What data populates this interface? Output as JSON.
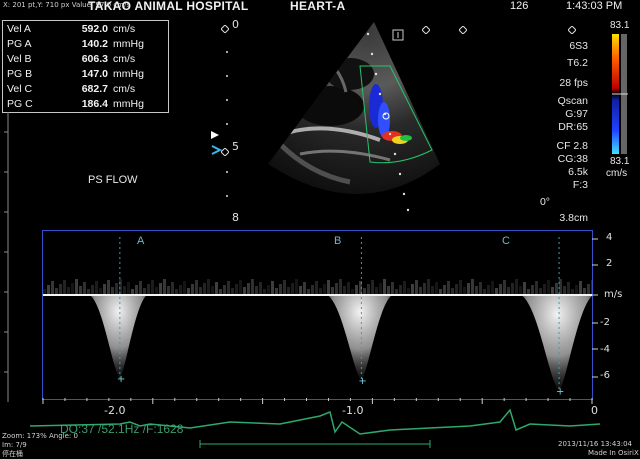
{
  "status_bar": {
    "cursor_info": "X: 201 pt,Y: 710 px Value: 97.0 cm/s",
    "hospital": "TAKAO ANIMAL HOSPITAL",
    "preset": "HEART-A",
    "frame_no": "126",
    "time": "1:43:03 PM"
  },
  "measurements": [
    {
      "label": "Vel  A",
      "value": "592.0",
      "unit": "cm/s"
    },
    {
      "label": "PG  A",
      "value": "140.2",
      "unit": "mmHg"
    },
    {
      "label": "Vel  B",
      "value": "606.3",
      "unit": "cm/s"
    },
    {
      "label": "PG  B",
      "value": "147.0",
      "unit": "mmHg"
    },
    {
      "label": "Vel  C",
      "value": "682.7",
      "unit": "cm/s"
    },
    {
      "label": "PG  C",
      "value": "186.4",
      "unit": "mmHg"
    }
  ],
  "probe": {
    "name": "6S3",
    "tissue": "T6.2",
    "fps": "28 fps",
    "qscan": "Qscan",
    "gain": "G:97",
    "dr": "DR:65",
    "cf": "CF 2.8",
    "cg": "CG:38",
    "prf": "6.5k",
    "filter": "F:3",
    "angle": "0°",
    "depth": "3.8cm"
  },
  "color_bar": {
    "top": "83.1",
    "bottom": "83.1",
    "unit": "cm/s",
    "colors": [
      "#ffe000",
      "#ff6000",
      "#c00000",
      "#2040ff",
      "#40e0ff"
    ]
  },
  "depth_marks": [
    "0",
    "5",
    "8"
  ],
  "sector_label": "PS FLOW",
  "doppler": {
    "velocity_ticks": [
      "4",
      "2",
      "m/s",
      "-2",
      "-4",
      "-6"
    ],
    "time_ticks": [
      "-2.0",
      "-1.0",
      "0"
    ],
    "markers": [
      "A",
      "B",
      "C"
    ],
    "info": "DO:37  /52.1Hz  /F:1628"
  },
  "footer": {
    "zoom": "Zoom: 173%  Angle: 0",
    "im": "Im: 7/9",
    "name": "停在桶",
    "date": "2013/11/16 13:43:04",
    "made_in": "Made In OsiriX"
  },
  "chart_data": {
    "type": "line",
    "title": "",
    "xlabel": "",
    "ylabel": "m/s",
    "xlim": [
      -2.5,
      0
    ],
    "ylim": [
      -7,
      4.5
    ],
    "series": [
      {
        "x": [
          -2.15,
          -1.05,
          -0.15
        ],
        "y": [
          -5.92,
          -6.06,
          -6.83
        ]
      }
    ]
  }
}
